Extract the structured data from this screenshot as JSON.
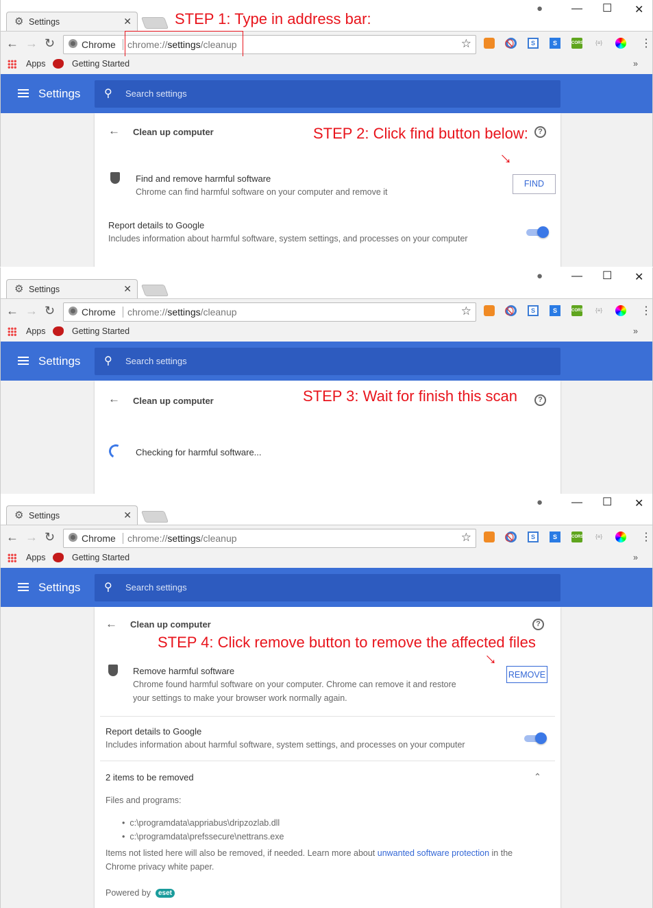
{
  "windows": [
    {
      "tab_title": "Settings",
      "omnibox_chip": "Chrome",
      "url_prefix": "chrome://",
      "url_path": "settings",
      "url_suffix": "/cleanup",
      "bookmarks": [
        "Apps",
        "Getting Started"
      ],
      "settings_title": "Settings",
      "search_placeholder": "Search settings"
    },
    {
      "tab_title": "Settings",
      "omnibox_chip": "Chrome",
      "url_prefix": "chrome://",
      "url_path": "settings",
      "url_suffix": "/cleanup",
      "bookmarks": [
        "Apps",
        "Getting Started"
      ],
      "settings_title": "Settings",
      "search_placeholder": "Search settings"
    },
    {
      "tab_title": "Settings",
      "omnibox_chip": "Chrome",
      "url_prefix": "chrome://",
      "url_path": "settings",
      "url_suffix": "/cleanup",
      "bookmarks": [
        "Apps",
        "Getting Started"
      ],
      "settings_title": "Settings",
      "search_placeholder": "Search settings"
    }
  ],
  "extensions": [
    "metamask-icon",
    "block-icon",
    "s-icon",
    "s-blue-icon",
    "cors-icon",
    "json-icon",
    "color-wheel-icon"
  ],
  "extension_labels": {
    "s": "S",
    "s_blue": "S",
    "cors": "CORS",
    "json": "{≡}"
  },
  "steps": {
    "step1": "STEP 1: Type in address bar:",
    "step2": "STEP 2: Click find button below:",
    "step3": "STEP 3: Wait for finish this scan",
    "step4": "STEP 4: Click remove button to remove the affected files"
  },
  "panel1": {
    "heading": "Clean up computer",
    "find_title": "Find and remove harmful software",
    "find_desc": "Chrome can find harmful software on your computer and remove it",
    "find_button": "FIND",
    "report_title": "Report details to Google",
    "report_desc": "Includes information about harmful software, system settings, and processes on your computer",
    "report_enabled": true
  },
  "panel2": {
    "heading": "Clean up computer",
    "status": "Checking for harmful software..."
  },
  "panel3": {
    "heading": "Clean up computer",
    "remove_title": "Remove harmful software",
    "remove_desc_1": "Chrome found harmful software on your computer. Chrome can remove it and restore",
    "remove_desc_2": "your settings to make your browser work normally again.",
    "remove_button": "REMOVE",
    "report_title": "Report details to Google",
    "report_desc": "Includes information about harmful software, system settings, and processes on your computer",
    "report_enabled": true,
    "items_header": "2 items to be removed",
    "files_label": "Files and programs:",
    "files": [
      "c:\\programdata\\appriabus\\dripzozlab.dll",
      "c:\\programdata\\prefssecure\\nettrans.exe"
    ],
    "note_before": "Items not listed here will also be removed, if needed. Learn more about ",
    "note_link": "unwanted software protection",
    "note_after": " in the",
    "note_line2": "Chrome privacy white paper.",
    "powered_by": "Powered by",
    "brand": "eset"
  },
  "colors": {
    "accent": "#3b6fd6",
    "step_text": "#e8141c",
    "link": "#3367d6"
  }
}
